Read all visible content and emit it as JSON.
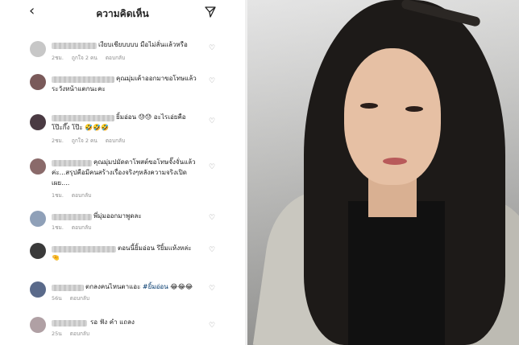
{
  "header": {
    "back_glyph": "‹",
    "title": "ความคิดเห็น"
  },
  "comments": [
    {
      "avatar_color": "#c7c7c7",
      "text_lines": [
        "เงียบเชียบบบบ มือไม่ลั่นแล้วหรือ"
      ],
      "time": "2ชม.",
      "likes": "ถูกใจ 2 คน",
      "reply": "ตอบกลับ"
    },
    {
      "avatar_color": "#7a5a5a",
      "text_lines": [
        "คุณมุ่มเค้าออกมาขอโทษแล้ว",
        "ระวังหน้าแตกนะคะ"
      ],
      "time": "",
      "likes": "",
      "reply": ""
    },
    {
      "avatar_color": "#4a3a42",
      "text_lines": [
        "ยิ้มอ่อน 😓😓 อะไรเอ่ยคือ",
        "โป๊ะกึ๊ง โป๊ะ 🤣🤣🤣"
      ],
      "time": "2ชม.",
      "likes": "ถูกใจ 2 คน",
      "reply": "ตอบกลับ"
    },
    {
      "avatar_color": "#8a6a6a",
      "text_lines": [
        "คุณมุ่มปมัดดาโพสต์ขอโทษจั๊งจั่นแล้ว",
        "ค่ะ...สรุปคือมีคนสร้างเรื่องจริงๆหลังความจริงเปิด",
        "เผย...."
      ],
      "time": "1ชม.",
      "likes": "",
      "reply": "ตอบกลับ"
    },
    {
      "avatar_color": "#8fa0b8",
      "text_lines": [
        "พี่มุ่มออกมาพูดละ"
      ],
      "time": "1ชม.",
      "likes": "",
      "reply": "ตอบกลับ"
    },
    {
      "avatar_color": "#3a3a3a",
      "text_lines": [
        "ตอนนี้ยิ้มอ่อน รึยิ้มแห้งหล่ะ",
        "🤏"
      ],
      "time": "",
      "likes": "",
      "reply": ""
    },
    {
      "avatar_color": "#5a6a8a",
      "text_lines": [
        "ตกลงคนไหนตาแอะ "
      ],
      "hashtag": "#ยิ้มอ่อน",
      "emoji": " 😂😂😂",
      "time": "56น",
      "likes": "",
      "reply": "ตอบกลับ"
    },
    {
      "avatar_color": "#b0a0a4",
      "text_lines": [
        "รอ ฟัง คำ แถลง"
      ],
      "time": "25น",
      "likes": "",
      "reply": "ตอบกลับ"
    }
  ],
  "heart_glyph": "♡"
}
